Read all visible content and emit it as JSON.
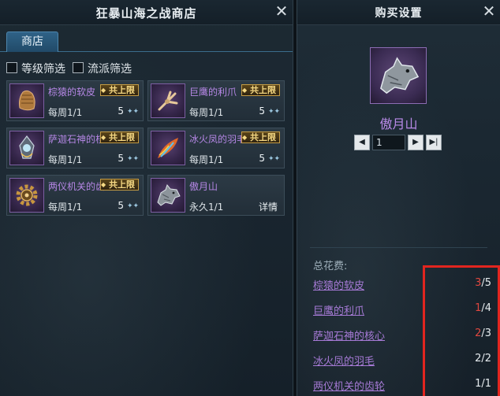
{
  "shop": {
    "title": "狂暴山海之战商店",
    "tab": "商店",
    "filters": [
      {
        "label": "等级筛选",
        "checked": false
      },
      {
        "label": "流派筛选",
        "checked": false
      }
    ],
    "items": [
      {
        "name": "棕猿的软皮",
        "badge": "共上限",
        "freq": "每周1/1",
        "price": "5",
        "icon": "pelt-icon"
      },
      {
        "name": "巨鹰的利爪",
        "badge": "共上限",
        "freq": "每周1/1",
        "price": "5",
        "icon": "claw-icon"
      },
      {
        "name": "萨迦石神的核",
        "badge": "共上限",
        "freq": "每周1/1",
        "price": "5",
        "icon": "core-icon"
      },
      {
        "name": "冰火凤的羽毛",
        "badge": "共上限",
        "freq": "每周1/1",
        "price": "5",
        "icon": "feather-icon"
      },
      {
        "name": "两仪机关的齿",
        "badge": "共上限",
        "freq": "每周1/1",
        "price": "5",
        "icon": "gear-icon"
      },
      {
        "name": "傲月山",
        "badge": "",
        "freq": "永久1/1",
        "price": "",
        "detail": "详情",
        "icon": "wolf-mount-icon"
      }
    ]
  },
  "purchase": {
    "title": "购买设置",
    "item_name": "傲月山",
    "quantity": "1",
    "cost_label": "总花费:",
    "costs": [
      {
        "name": "棕猿的软皮",
        "have": "3",
        "need": "/5",
        "ok": false
      },
      {
        "name": "巨鹰的利爪",
        "have": "1",
        "need": "/4",
        "ok": false
      },
      {
        "name": "萨迦石神的核心",
        "have": "2",
        "need": "/3",
        "ok": false
      },
      {
        "name": "冰火凤的羽毛",
        "have": "2",
        "need": "/2",
        "ok": true
      },
      {
        "name": "两仪机关的齿轮",
        "have": "1",
        "need": "/1",
        "ok": true
      }
    ]
  },
  "colors": {
    "highlight": "#e2251f",
    "item_name": "#b98ae8",
    "badge_gold": "#f6d983",
    "insufficient": "#e0473f"
  }
}
